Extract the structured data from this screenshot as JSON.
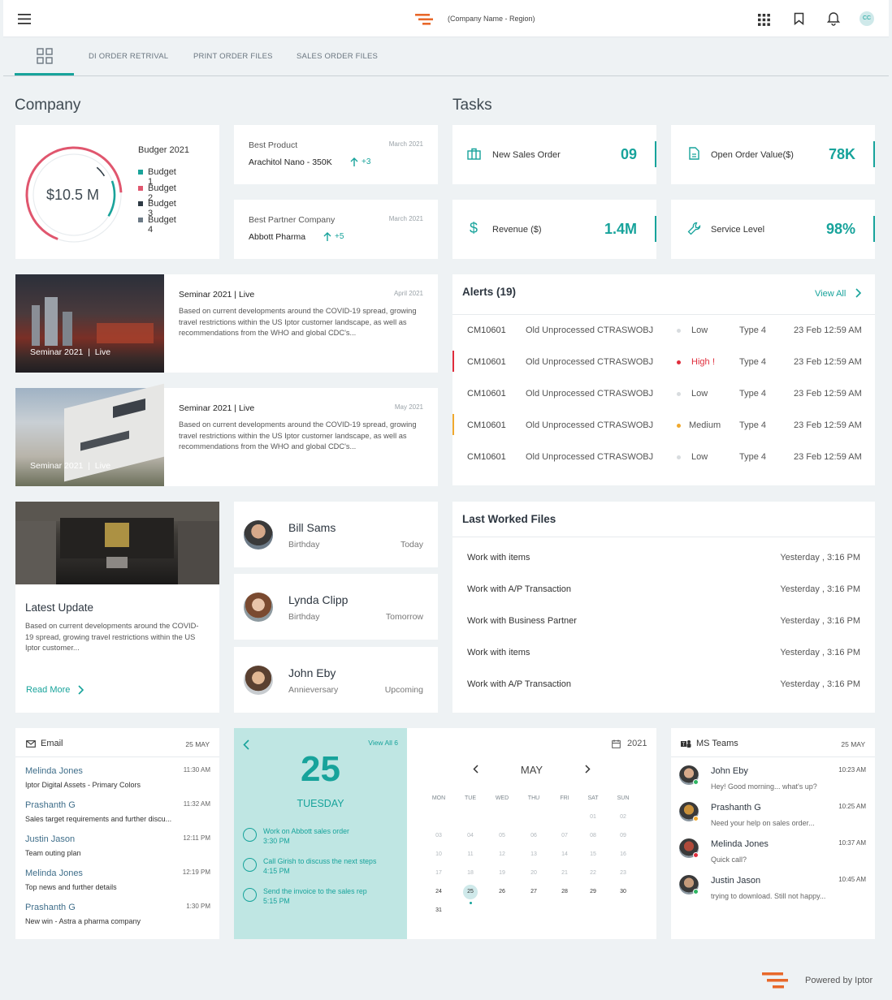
{
  "header": {
    "company": "(Company Name - Region)",
    "avatar_initials": "CC"
  },
  "tabs": [
    "DI ORDER RETRIVAL",
    "PRINT ORDER FILES",
    "SALES ORDER FILES"
  ],
  "company": {
    "title": "Company",
    "budget": {
      "title": "Budger 2021",
      "total": "$10.5 M",
      "legend": [
        {
          "label": "Budget 1",
          "color": "#1aa39a"
        },
        {
          "label": "Budget 2",
          "color": "#e0566e"
        },
        {
          "label": "Budget 3",
          "color": "#2e3a44"
        },
        {
          "label": "Budget 4",
          "color": "#6c7a86"
        }
      ]
    },
    "best_product": {
      "label": "Best Product",
      "date": "March 2021",
      "value": "Arachitol Nano - 350K",
      "delta": "+3"
    },
    "best_partner": {
      "label": "Best Partner Company",
      "date": "March 2021",
      "value": "Abbott Pharma",
      "delta": "+5"
    }
  },
  "tasks": {
    "title": "Tasks",
    "stats": [
      {
        "label": "New Sales Order",
        "value": "09",
        "icon": "briefcase-icon"
      },
      {
        "label": "Open Order Value($)",
        "value": "78K",
        "icon": "document-icon"
      },
      {
        "label": "Revenue ($)",
        "value": "1.4M",
        "icon": "dollar-icon"
      },
      {
        "label": "Service Level",
        "value": "98%",
        "icon": "wrench-icon"
      }
    ]
  },
  "seminars": [
    {
      "title": "Seminar 2021",
      "status": "Live",
      "date": "April 2021",
      "overlay": "Seminar 2021  |  Live",
      "text": "Based on current developments around the COVID-19 spread, growing travel restrictions within the US Iptor customer landscape, as well as recommendations from the WHO and global CDC's..."
    },
    {
      "title": "Seminar 2021",
      "status": "Live",
      "date": "May 2021",
      "overlay": "Seminar 2021  |  Live",
      "text": "Based on current developments around the COVID-19 spread, growing travel restrictions within the US Iptor customer landscape, as well as recommendations from the WHO and global CDC's..."
    }
  ],
  "alerts": {
    "title": "Alerts",
    "count": "(19)",
    "view_all": "View All",
    "rows": [
      {
        "id": "CM10601",
        "desc": "Old Unprocessed CTRASWOBJ",
        "priority": "Low",
        "flag": "",
        "type": "Type 4",
        "time": "23 Feb 12:59 AM",
        "color": "#d8dcdf"
      },
      {
        "id": "CM10601",
        "desc": "Old Unprocessed CTRASWOBJ",
        "priority": "High",
        "flag": "!",
        "type": "Type 4",
        "time": "23 Feb 12:59 AM",
        "color": "#e02d3c"
      },
      {
        "id": "CM10601",
        "desc": "Old Unprocessed CTRASWOBJ",
        "priority": "Low",
        "flag": "",
        "type": "Type 4",
        "time": "23 Feb 12:59 AM",
        "color": "#d8dcdf"
      },
      {
        "id": "CM10601",
        "desc": "Old Unprocessed CTRASWOBJ",
        "priority": "Medium",
        "flag": "",
        "type": "Type 4",
        "time": "23 Feb 12:59 AM",
        "color": "#f0a92e"
      },
      {
        "id": "CM10601",
        "desc": "Old Unprocessed CTRASWOBJ",
        "priority": "Low",
        "flag": "",
        "type": "Type 4",
        "time": "23 Feb 12:59 AM",
        "color": "#d8dcdf"
      }
    ]
  },
  "latest_update": {
    "title": "Latest Update",
    "text": "Based on current developments around the COVID-19 spread, growing travel restrictions within the US Iptor customer...",
    "read_more": "Read More"
  },
  "people": [
    {
      "name": "Bill Sams",
      "event": "Birthday",
      "when": "Today"
    },
    {
      "name": "Lynda Clipp",
      "event": "Birthday",
      "when": "Tomorrow"
    },
    {
      "name": "John Eby",
      "event": "Annieversary",
      "when": "Upcoming"
    }
  ],
  "files": {
    "title": "Last Worked Files",
    "rows": [
      {
        "name": "Work with items",
        "time": "Yesterday , 3:16 PM"
      },
      {
        "name": "Work with A/P Transaction",
        "time": "Yesterday , 3:16 PM"
      },
      {
        "name": "Work with Business Partner",
        "time": "Yesterday , 3:16 PM"
      },
      {
        "name": "Work with items",
        "time": "Yesterday , 3:16 PM"
      },
      {
        "name": "Work with A/P Transaction",
        "time": "Yesterday , 3:16 PM"
      }
    ]
  },
  "email": {
    "title": "Email",
    "date": "25 MAY",
    "items": [
      {
        "from": "Melinda Jones",
        "time": "11:30 AM",
        "subject": "Iptor Digital Assets - Primary Colors"
      },
      {
        "from": "Prashanth G",
        "time": "11:32 AM",
        "subject": "Sales target requirements and further discu..."
      },
      {
        "from": "Justin Jason",
        "time": "12:11 PM",
        "subject": "Team outing plan"
      },
      {
        "from": "Melinda Jones",
        "time": "12:19 PM",
        "subject": "Top news and further details"
      },
      {
        "from": "Prashanth G",
        "time": "1:30 PM",
        "subject": "New win - Astra a pharma company"
      }
    ]
  },
  "agenda": {
    "view_all": "View All 6",
    "day": "25",
    "weekday": "TUESDAY",
    "items": [
      {
        "title": "Work on Abbott sales order",
        "time": "3:30 PM"
      },
      {
        "title": "Call Girish to discuss the next steps",
        "time": "4:15 PM"
      },
      {
        "title": "Send the invoice to the sales rep",
        "time": "5:15 PM"
      }
    ]
  },
  "calendar": {
    "year": "2021",
    "month": "MAY",
    "weekdays": [
      "MON",
      "TUE",
      "WED",
      "THU",
      "FRI",
      "SAT",
      "SUN"
    ],
    "weeks": [
      [
        "",
        "",
        "",
        "",
        "",
        "01",
        "02"
      ],
      [
        "03",
        "04",
        "05",
        "06",
        "07",
        "08",
        "09"
      ],
      [
        "10",
        "11",
        "12",
        "13",
        "14",
        "15",
        "16"
      ],
      [
        "17",
        "18",
        "19",
        "20",
        "21",
        "22",
        "23"
      ],
      [
        "24",
        "25",
        "26",
        "27",
        "28",
        "29",
        "30"
      ],
      [
        "31",
        "",
        "",
        "",
        "",
        "",
        ""
      ]
    ],
    "today": "25"
  },
  "teams": {
    "title": "MS Teams",
    "date": "25 MAY",
    "items": [
      {
        "name": "John Eby",
        "time": "10:23 AM",
        "msg": "Hey! Good morning... what's up?",
        "status": "#2fb562"
      },
      {
        "name": "Prashanth G",
        "time": "10:25 AM",
        "msg": "Need your help on sales order...",
        "status": "#f0a92e"
      },
      {
        "name": "Melinda Jones",
        "time": "10:37 AM",
        "msg": "Quick call?",
        "status": "#e02d3c"
      },
      {
        "name": "Justin Jason",
        "time": "10:45 AM",
        "msg": "trying to download. Still not happy...",
        "status": "#2fb562"
      }
    ]
  },
  "footer": {
    "powered": "Powered by Iptor"
  }
}
